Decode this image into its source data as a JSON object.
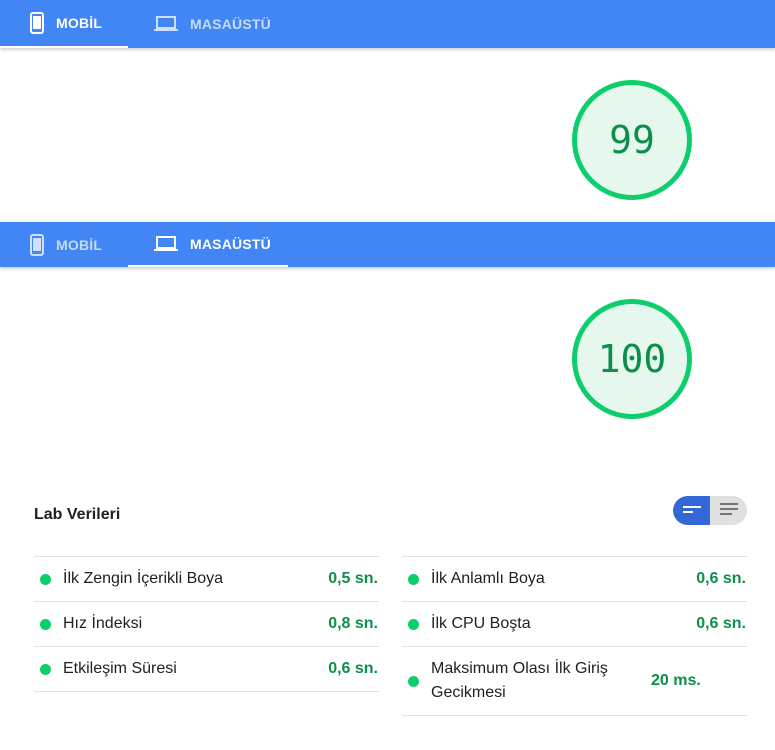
{
  "tabs_top": {
    "mobile_label": "MOBİL",
    "desktop_label": "MASAÜSTÜ",
    "active": "mobile"
  },
  "score_top": "99",
  "tabs_bottom": {
    "mobile_label": "MOBİL",
    "desktop_label": "MASAÜSTÜ",
    "active": "desktop"
  },
  "score_bottom": "100",
  "lab": {
    "title": "Lab Verileri",
    "left": [
      {
        "label": "İlk Zengin İçerikli Boya",
        "value": "0,5 sn."
      },
      {
        "label": "Hız İndeksi",
        "value": "0,8 sn."
      },
      {
        "label": "Etkileşim Süresi",
        "value": "0,6 sn."
      }
    ],
    "right": [
      {
        "label": "İlk Anlamlı Boya",
        "value": "0,6 sn."
      },
      {
        "label": "İlk CPU Boşta",
        "value": "0,6 sn."
      },
      {
        "label": "Maksimum Olası İlk Giriş Gecikmesi",
        "value": "20 ms."
      }
    ]
  },
  "colors": {
    "header": "#4285f4",
    "pass": "#0cce6b",
    "pass_text": "#0c8f4b",
    "toggle_active": "#3367d6"
  },
  "icons": {
    "mobile": "phone-icon",
    "desktop": "laptop-icon",
    "view_compact": "view-compact-icon",
    "view_list": "view-list-icon"
  }
}
